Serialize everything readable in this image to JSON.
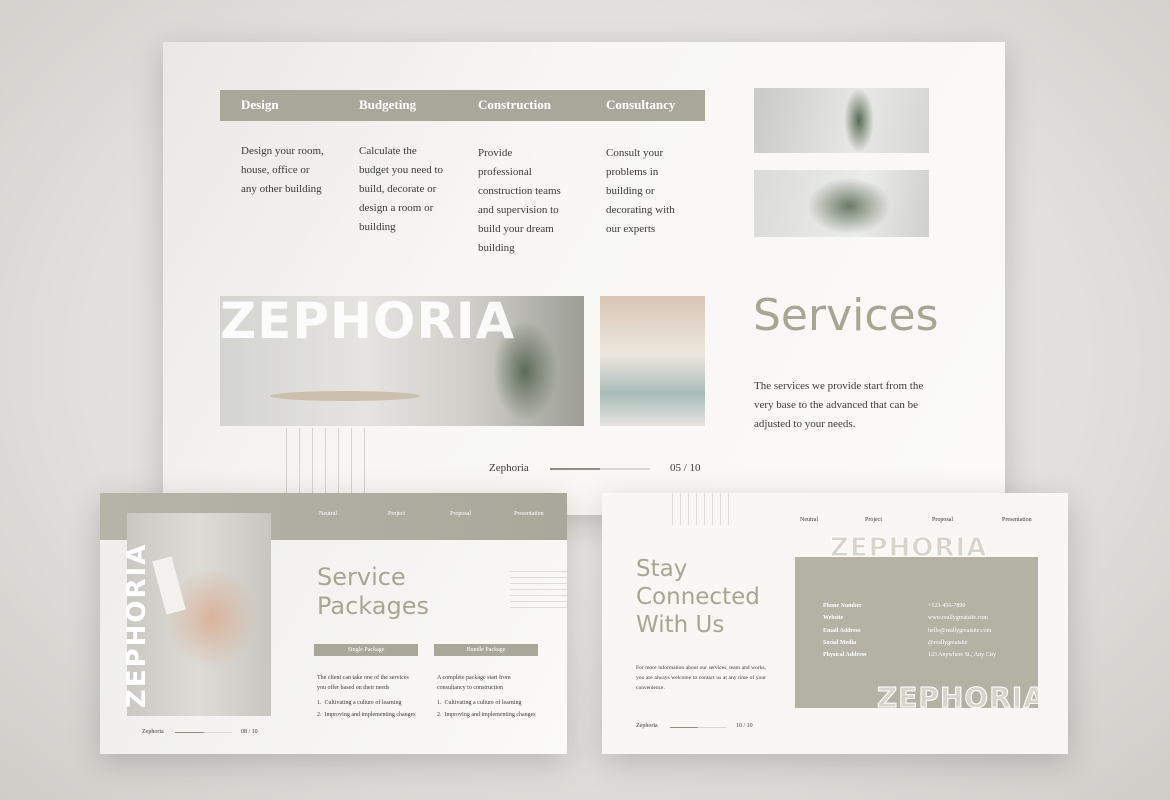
{
  "main_slide": {
    "tabs": [
      "Design",
      "Budgeting",
      "Construction",
      "Consultancy"
    ],
    "descriptions": [
      "Design your room, house, office or any other building",
      "Calculate the budget you need to build, decorate or design a room or building",
      "Provide professional construction teams and supervision to build your dream building",
      "Consult your problems in building or decorating with our experts"
    ],
    "overlay_text": "ZEPHORIA",
    "title": "Services",
    "body": "The services we provide start from the very base to the advanced that can be adjusted to your needs.",
    "footer": {
      "brand": "Zephoria",
      "page": "05 / 10",
      "progress": 0.5
    }
  },
  "slide_packages": {
    "nav": [
      "Neutral",
      "Project",
      "Proposal",
      "Presentation"
    ],
    "vertical_text": "ZEPHORIA",
    "title_line1": "Service",
    "title_line2": "Packages",
    "packages": [
      {
        "label": "Single Package",
        "desc": "The client can take one of the services you offer based on their needs",
        "items": [
          "1.  Cultivating a culture of learning",
          "2.  Improving and implementing changes"
        ]
      },
      {
        "label": "Bundle Package",
        "desc": "A complete package start from consultancy to construction",
        "items": [
          "1.  Cultivating a culture of learning",
          "2.  Improving and implementing changes"
        ]
      }
    ],
    "footer": {
      "brand": "Zephoria",
      "page": "08 / 10",
      "progress": 0.5
    }
  },
  "slide_contact": {
    "nav": [
      "Neutral",
      "Project",
      "Proposal",
      "Presentation"
    ],
    "title_line1": "Stay",
    "title_line2": "Connected",
    "title_line3": "With Us",
    "body": "For more information about our services, team and works, you are always welcome to contact us at any time of your convenience.",
    "outline_text": "ZEPHORIA",
    "contacts": [
      {
        "label": "Phone Number",
        "value": "+123-456-7890"
      },
      {
        "label": "Website",
        "value": "www.reallygreatsite.com"
      },
      {
        "label": "Email Address",
        "value": "hello@reallygreatsite.com"
      },
      {
        "label": "Social Media",
        "value": "@reallygreatsite"
      },
      {
        "label": "Physical Address",
        "value": "123 Anywhere St., Any City"
      }
    ],
    "footer": {
      "brand": "Zephoria",
      "page": "10 / 10",
      "progress": 0.5
    }
  },
  "colors": {
    "accent": "#a6a696",
    "bar": "#a8a89a"
  }
}
